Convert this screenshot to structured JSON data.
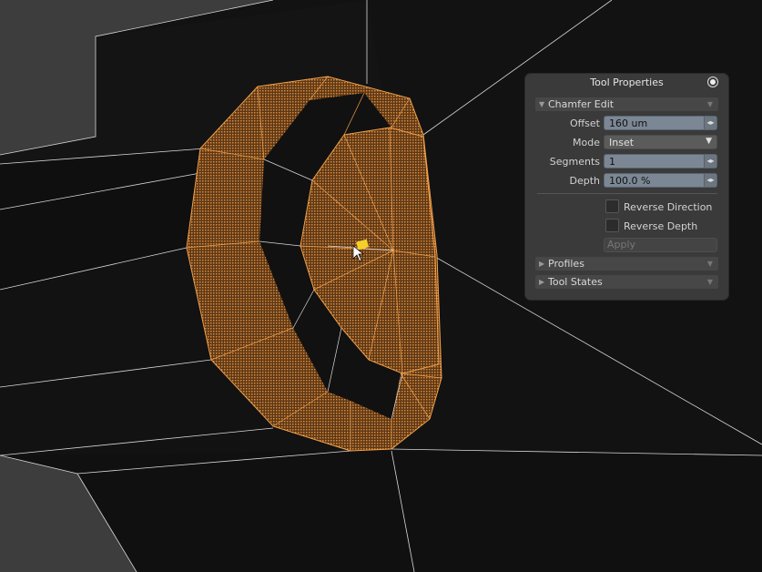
{
  "panel": {
    "title": "Tool Properties",
    "section_title": "Chamfer Edit",
    "fields": {
      "offset_label": "Offset",
      "offset_value": "160 um",
      "mode_label": "Mode",
      "mode_value": "Inset",
      "segments_label": "Segments",
      "segments_value": "1",
      "depth_label": "Depth",
      "depth_value": "100.0 %"
    },
    "options": {
      "reverse_direction_label": "Reverse Direction",
      "reverse_direction_checked": false,
      "reverse_depth_label": "Reverse Depth",
      "reverse_depth_checked": false,
      "apply_label": "Apply"
    },
    "collapsed_sections": [
      "Profiles",
      "Tool States"
    ]
  },
  "colors": {
    "viewport_bg": "#121212",
    "background_mesh": "#3d3d3d",
    "wire": "#d8d8d8",
    "selection": "#f2a04a",
    "panel_bg": "#3a3a3a",
    "field_bg": "#7b8794",
    "handle": "#f5d02a"
  },
  "icons": {
    "titlebar": "radio-dot-icon",
    "section_expand": "triangle-down-icon",
    "section_collapsed": "triangle-right-icon",
    "spin": "spin-arrows-icon",
    "dropdown": "chevron-down-icon",
    "cursor": "arrow-cursor-icon"
  }
}
